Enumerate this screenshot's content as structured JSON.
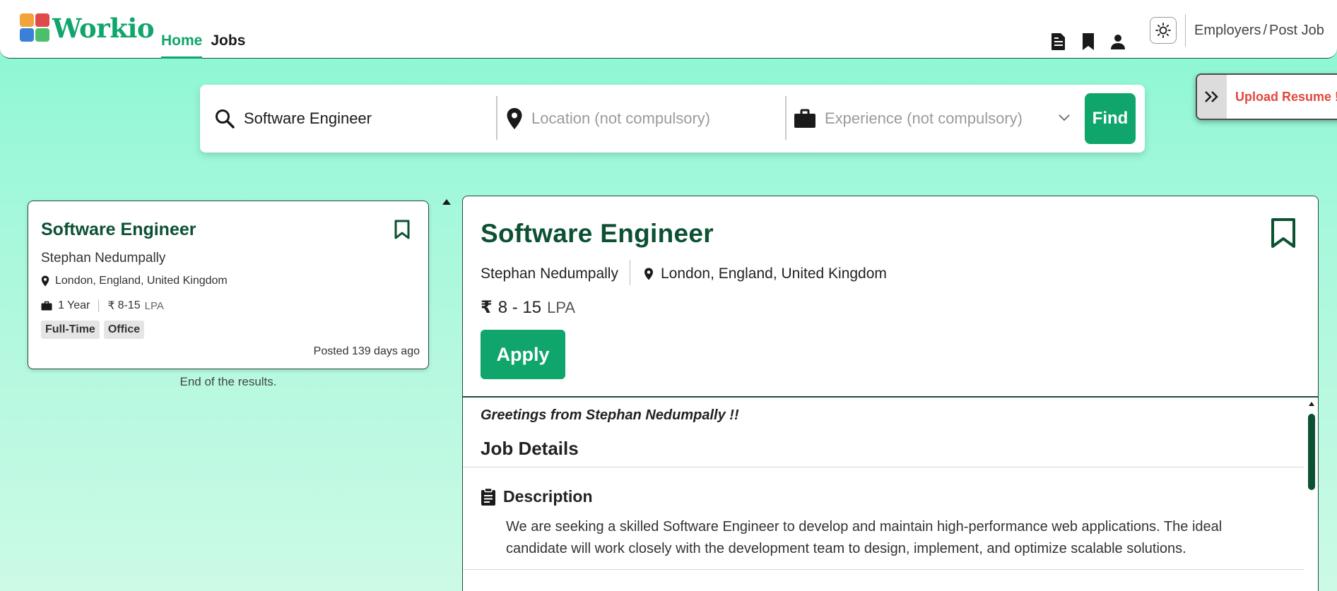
{
  "app": {
    "name": "Workio",
    "colors": {
      "brand": "#0fa56b",
      "title": "#0c5132",
      "accent_red": "#e0483e"
    }
  },
  "nav": {
    "links": [
      {
        "label": "Home",
        "active": true
      },
      {
        "label": "Jobs",
        "active": false
      }
    ],
    "icons": [
      "document-icon",
      "bookmark-icon",
      "user-icon"
    ],
    "theme_icon": "sun-icon",
    "employers": {
      "left": "Employers",
      "sep": "/",
      "right": "Post Job"
    }
  },
  "search": {
    "query": "Software Engineer",
    "location_placeholder": "Location (not compulsory)",
    "experience_placeholder": "Experience (not compulsory)",
    "find_label": "Find"
  },
  "upload": {
    "label": "Upload Resume !"
  },
  "results": [
    {
      "title": "Software Engineer",
      "company": "Stephan Nedumpally",
      "location": "London, England, United Kingdom",
      "experience": "1 Year",
      "salary": "8-15",
      "salary_unit": "LPA",
      "tags": [
        "Full-Time",
        "Office"
      ],
      "posted": "Posted 139 days ago"
    }
  ],
  "end_of_results": "End of the results.",
  "detail": {
    "title": "Software Engineer",
    "company": "Stephan Nedumpally",
    "location": "London, England, United Kingdom",
    "salary": "8 - 15",
    "salary_unit": "LPA",
    "apply_label": "Apply",
    "greeting": "Greetings from Stephan Nedumpally !!",
    "job_details_heading": "Job Details",
    "description_heading": "Description",
    "description": "We are seeking a skilled Software Engineer to develop and maintain high-performance web applications. The ideal candidate will work closely with the development team to design, implement, and optimize scalable solutions."
  }
}
